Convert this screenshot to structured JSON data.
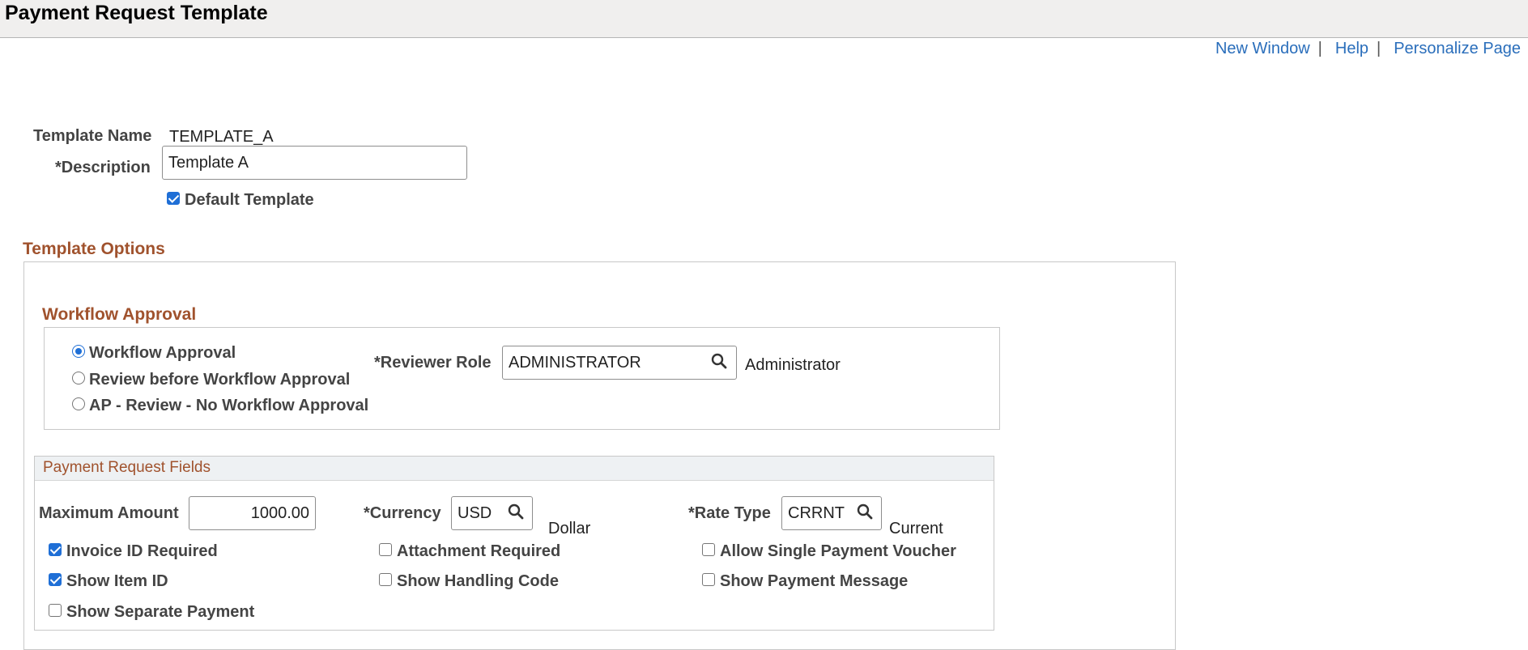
{
  "page": {
    "title": "Payment Request Template"
  },
  "links": {
    "new_window": "New Window",
    "help": "Help",
    "personalize": "Personalize Page",
    "separator": "|"
  },
  "template": {
    "name_label": "Template Name",
    "name_value": "TEMPLATE_A",
    "description_label": "*Description",
    "description_value": "Template A",
    "default_label": "Default Template",
    "default_checked": true
  },
  "options": {
    "title": "Template Options"
  },
  "workflow": {
    "title": "Workflow Approval",
    "radios": [
      {
        "label": "Workflow Approval",
        "checked": true
      },
      {
        "label": "Review before Workflow Approval",
        "checked": false
      },
      {
        "label": "AP - Review - No Workflow Approval",
        "checked": false
      }
    ],
    "reviewer_role_label": "*Reviewer Role",
    "reviewer_role_value": "ADMINISTRATOR",
    "reviewer_role_desc": "Administrator"
  },
  "fields": {
    "title": "Payment Request Fields",
    "max_amount_label": "Maximum Amount",
    "max_amount_value": "1000.00",
    "currency_label": "*Currency",
    "currency_value": "USD",
    "currency_desc": "Dollar",
    "rate_type_label": "*Rate Type",
    "rate_type_value": "CRRNT",
    "rate_type_desc": "Current",
    "checkboxes": [
      {
        "label": "Invoice ID Required",
        "checked": true
      },
      {
        "label": "Attachment Required",
        "checked": false
      },
      {
        "label": "Allow Single Payment Voucher",
        "checked": false
      },
      {
        "label": "Show Item ID",
        "checked": true
      },
      {
        "label": "Show Handling Code",
        "checked": false
      },
      {
        "label": "Show Payment Message",
        "checked": false
      },
      {
        "label": "Show Separate Payment",
        "checked": false
      }
    ]
  },
  "colors": {
    "link": "#2a6ebb",
    "group_title": "#a0522d",
    "checked": "#1f6fd6"
  },
  "icons": {
    "prompt": "search-icon"
  }
}
